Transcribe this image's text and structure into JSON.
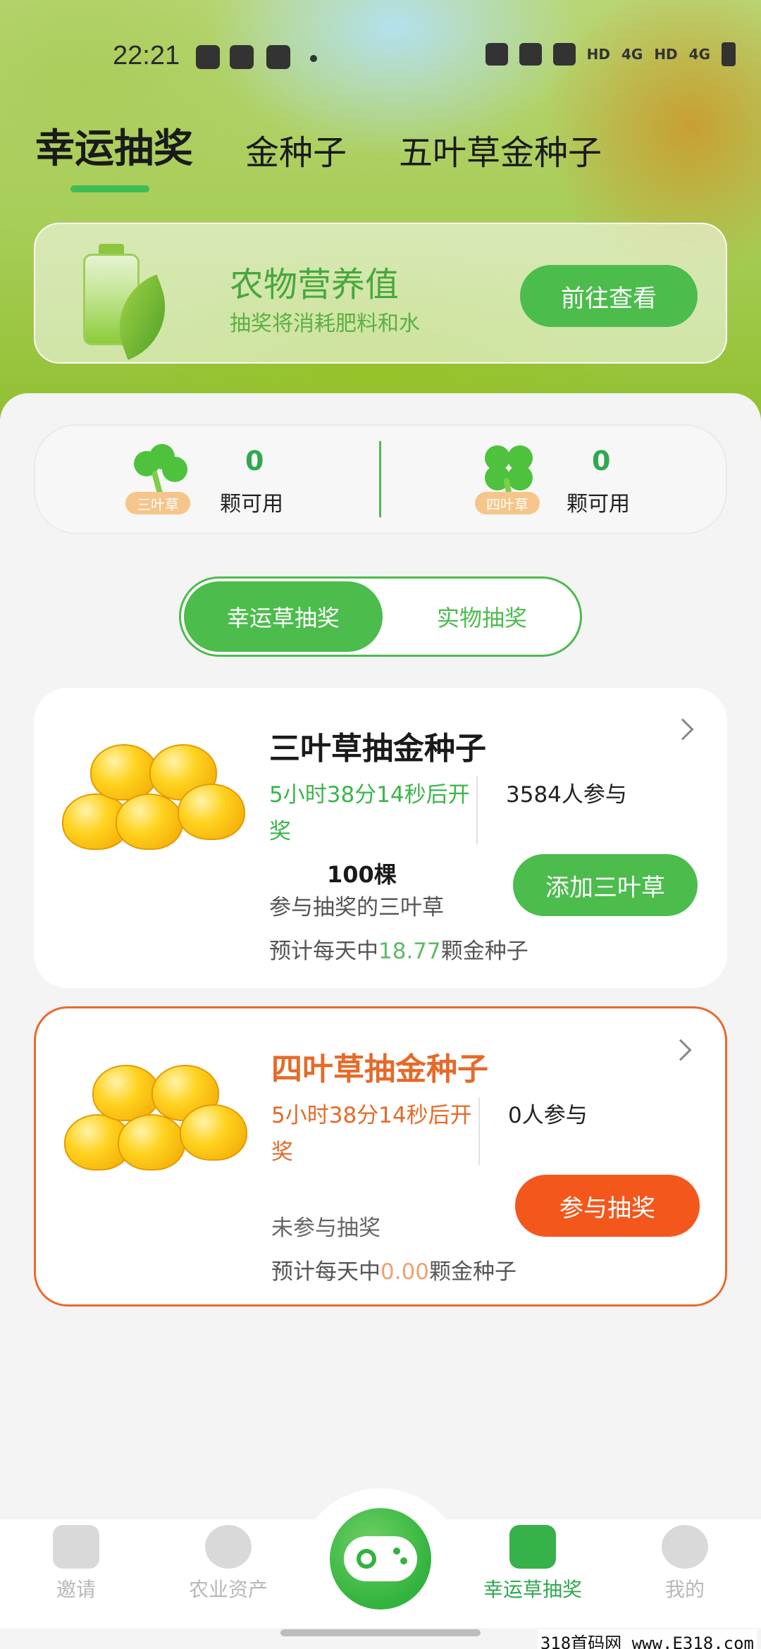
{
  "status_bar": {
    "time": "22:21",
    "hd_label": "HD",
    "net_label": "4G"
  },
  "top_tabs": [
    {
      "label": "幸运抽奖",
      "active": true
    },
    {
      "label": "金种子",
      "active": false
    },
    {
      "label": "五叶草金种子",
      "active": false
    }
  ],
  "nutrition": {
    "title": "农物营养值",
    "subtitle": "抽奖将消耗肥料和水",
    "button": "前往查看"
  },
  "clovers": {
    "three": {
      "tag": "三叶草",
      "count": "0",
      "label": "颗可用"
    },
    "four": {
      "tag": "四叶草",
      "count": "0",
      "label": "颗可用"
    }
  },
  "mode_toggle": {
    "active": "幸运草抽奖",
    "inactive": "实物抽奖"
  },
  "card1": {
    "title": "三叶草抽金种子",
    "countdown": "5小时38分14秒后开奖",
    "participants": "3584人参与",
    "amount": "100棵",
    "amount_label": "参与抽奖的三叶草",
    "button": "添加三叶草",
    "est_prefix": "预计每天中",
    "est_value": "18.77",
    "est_suffix": "颗金种子"
  },
  "card2": {
    "title": "四叶草抽金种子",
    "countdown": "5小时38分14秒后开奖",
    "participants": "0人参与",
    "status": "未参与抽奖",
    "button": "参与抽奖",
    "est_prefix": "预计每天中",
    "est_value": "0.00",
    "est_suffix": "颗金种子"
  },
  "bottom_nav": [
    {
      "label": "邀请",
      "icon": "mail-icon"
    },
    {
      "label": "农业资产",
      "icon": "plant-icon"
    },
    {
      "label": "",
      "icon": "gamepad-icon"
    },
    {
      "label": "幸运草抽奖",
      "icon": "gift-icon",
      "active": true
    },
    {
      "label": "我的",
      "icon": "profile-icon"
    }
  ],
  "watermark": "318首码网 www.E318.com",
  "colors": {
    "accent": "#4cbc4d",
    "orange": "#f4571c",
    "title_orange": "#e66a28"
  }
}
